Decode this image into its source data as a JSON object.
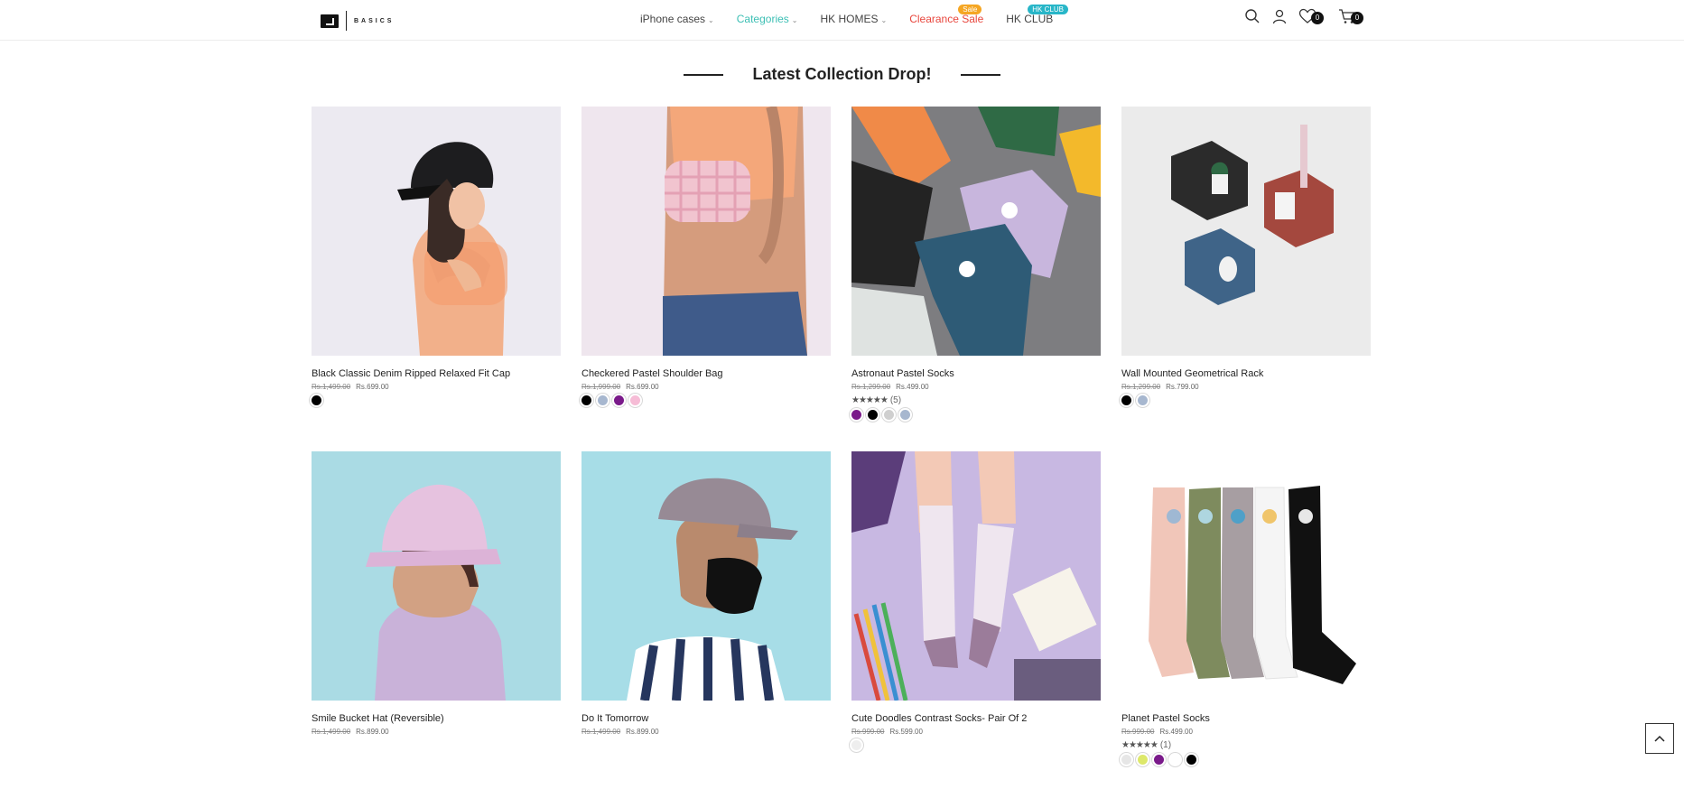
{
  "header": {
    "logo_text": "BASICS",
    "nav": [
      {
        "label": "iPhone cases",
        "style": "normal",
        "dropdown": true
      },
      {
        "label": "Categories",
        "style": "teal",
        "dropdown": true
      },
      {
        "label": "HK HOMES",
        "style": "normal",
        "dropdown": true
      },
      {
        "label": "Clearance Sale",
        "style": "red",
        "dropdown": false,
        "badge": "Sale"
      },
      {
        "label": "HK CLUB",
        "style": "normal",
        "dropdown": false,
        "badge": "HK CLUB"
      }
    ],
    "wishlist_count": "0",
    "cart_count": "0",
    "icons": [
      "search-icon",
      "user-icon",
      "heart-icon",
      "cart-icon"
    ]
  },
  "section": {
    "title": "Latest Collection Drop!"
  },
  "products": [
    {
      "name": "Black Classic Denim Ripped Relaxed Fit Cap",
      "old_price": "Rs.1,499.00",
      "price": "Rs.699.00",
      "rating": null,
      "reviews": null,
      "swatches": [
        "#000000"
      ]
    },
    {
      "name": "Checkered Pastel Shoulder Bag",
      "old_price": "Rs.1,999.00",
      "price": "Rs.699.00",
      "rating": null,
      "reviews": null,
      "swatches": [
        "#000000",
        "#a7b7cf",
        "#7a1a8a",
        "#f6bcd6"
      ]
    },
    {
      "name": "Astronaut Pastel Socks",
      "old_price": "Rs.1,299.00",
      "price": "Rs.499.00",
      "rating": 5,
      "reviews": "(5)",
      "swatches": [
        "#7a1a8a",
        "#000000",
        "#cfcfcf",
        "#a7b7cf"
      ]
    },
    {
      "name": "Wall Mounted Geometrical Rack",
      "old_price": "Rs.1,299.00",
      "price": "Rs.799.00",
      "rating": null,
      "reviews": null,
      "swatches": [
        "#000000",
        "#a7b7cf"
      ]
    },
    {
      "name": "Smile Bucket Hat (Reversible)",
      "old_price": "Rs.1,499.00",
      "price": "Rs.899.00",
      "rating": null,
      "reviews": null,
      "swatches": []
    },
    {
      "name": "Do It Tomorrow",
      "old_price": "Rs.1,499.00",
      "price": "Rs.899.00",
      "rating": null,
      "reviews": null,
      "swatches": []
    },
    {
      "name": "Cute Doodles Contrast Socks- Pair Of 2",
      "old_price": "Rs.999.00",
      "price": "Rs.599.00",
      "rating": null,
      "reviews": null,
      "swatches": [
        "#eeeeee"
      ]
    },
    {
      "name": "Planet Pastel Socks",
      "old_price": "Rs.999.00",
      "price": "Rs.499.00",
      "rating": 5,
      "reviews": "(1)",
      "swatches": [
        "#e6e6e6",
        "#dde86a",
        "#7a1a8a",
        "#ffffff",
        "#000000"
      ]
    }
  ],
  "colors": {
    "teal": "#3cbfb4",
    "sale_red": "#e8473e",
    "sale_badge": "#f5a623",
    "club_badge": "#28b6c8"
  }
}
